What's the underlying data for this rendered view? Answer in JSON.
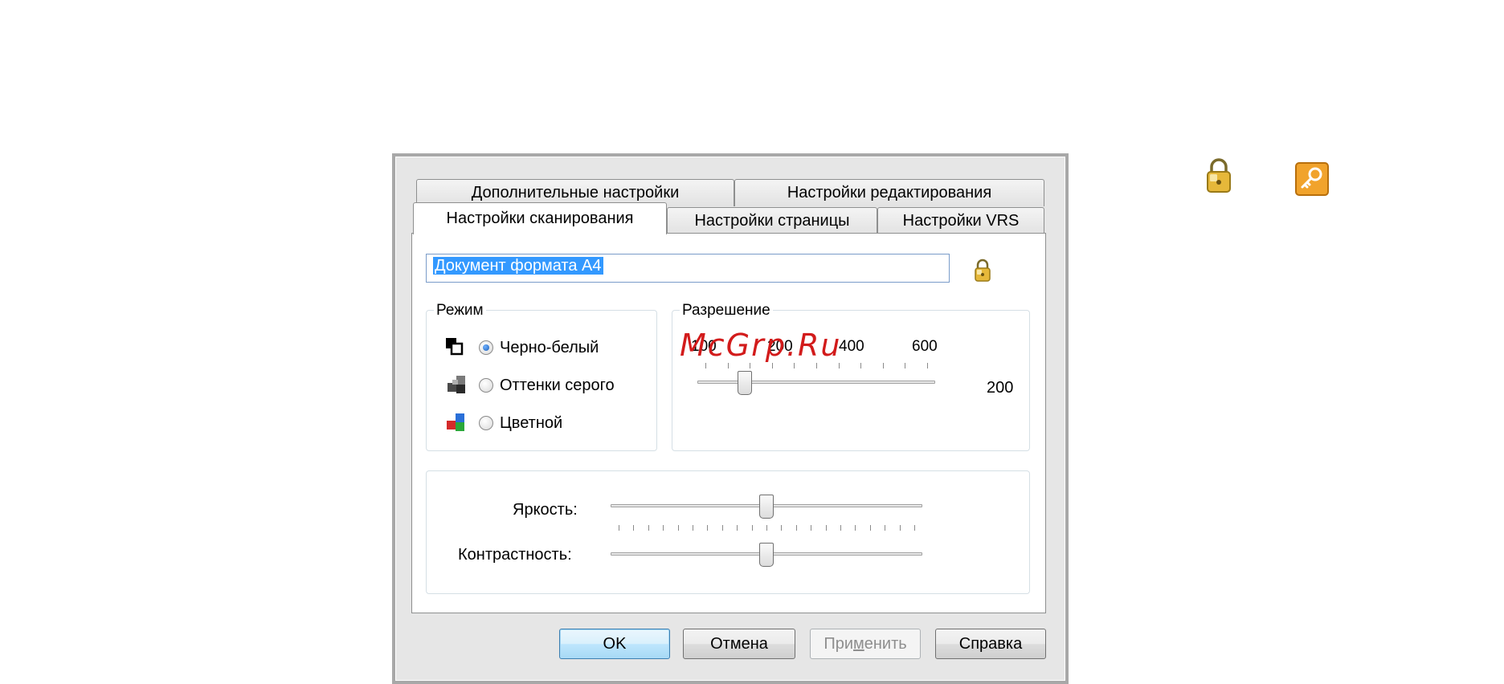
{
  "tabs": {
    "row_back": [
      "Дополнительные настройки",
      "Настройки редактирования"
    ],
    "row_front": [
      "Настройки сканирования",
      "Настройки страницы",
      "Настройки VRS"
    ],
    "active": "Настройки сканирования"
  },
  "preset": {
    "value": "Документ формата A4"
  },
  "mode": {
    "title": "Режим",
    "options": [
      "Черно-белый",
      "Оттенки серого",
      "Цветной"
    ],
    "selected": "Черно-белый"
  },
  "resolution": {
    "title": "Разрешение",
    "scale_labels": [
      "100",
      "200",
      "400",
      "600"
    ],
    "value": 200,
    "value_label": "200",
    "min": 100,
    "max": 600
  },
  "adjust": {
    "brightness_label": "Яркость:",
    "contrast_label": "Контрастность:",
    "brightness_level": 0.5,
    "contrast_level": 0.5
  },
  "buttons": {
    "ok": "OK",
    "cancel": "Отмена",
    "apply_pre": "При",
    "apply_underline": "м",
    "apply_post": "енить",
    "help": "Справка"
  },
  "watermark": "McGrp.Ru",
  "colors": {
    "accent": "#3399ff",
    "watermark": "#d21b1b"
  }
}
